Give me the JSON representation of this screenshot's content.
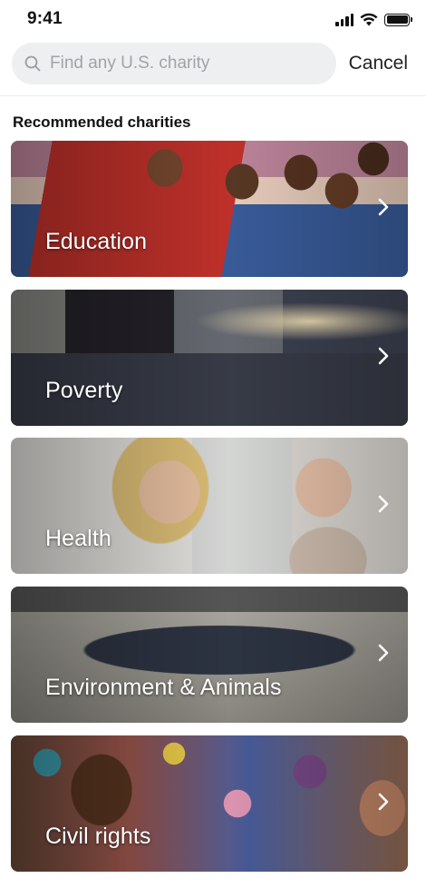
{
  "status_bar": {
    "time": "9:41",
    "icons": [
      "signal-icon",
      "wifi-icon",
      "battery-icon"
    ]
  },
  "search": {
    "placeholder": "Find any U.S. charity",
    "value": "",
    "cancel_label": "Cancel"
  },
  "section": {
    "title": "Recommended charities"
  },
  "categories": [
    {
      "label": "Education"
    },
    {
      "label": "Poverty"
    },
    {
      "label": "Health"
    },
    {
      "label": "Environment & Animals"
    },
    {
      "label": "Civil rights"
    }
  ],
  "colors": {
    "search_bg": "#eeeff1",
    "placeholder": "#a0a3a8",
    "text": "#111111",
    "card_label": "#ffffff"
  }
}
